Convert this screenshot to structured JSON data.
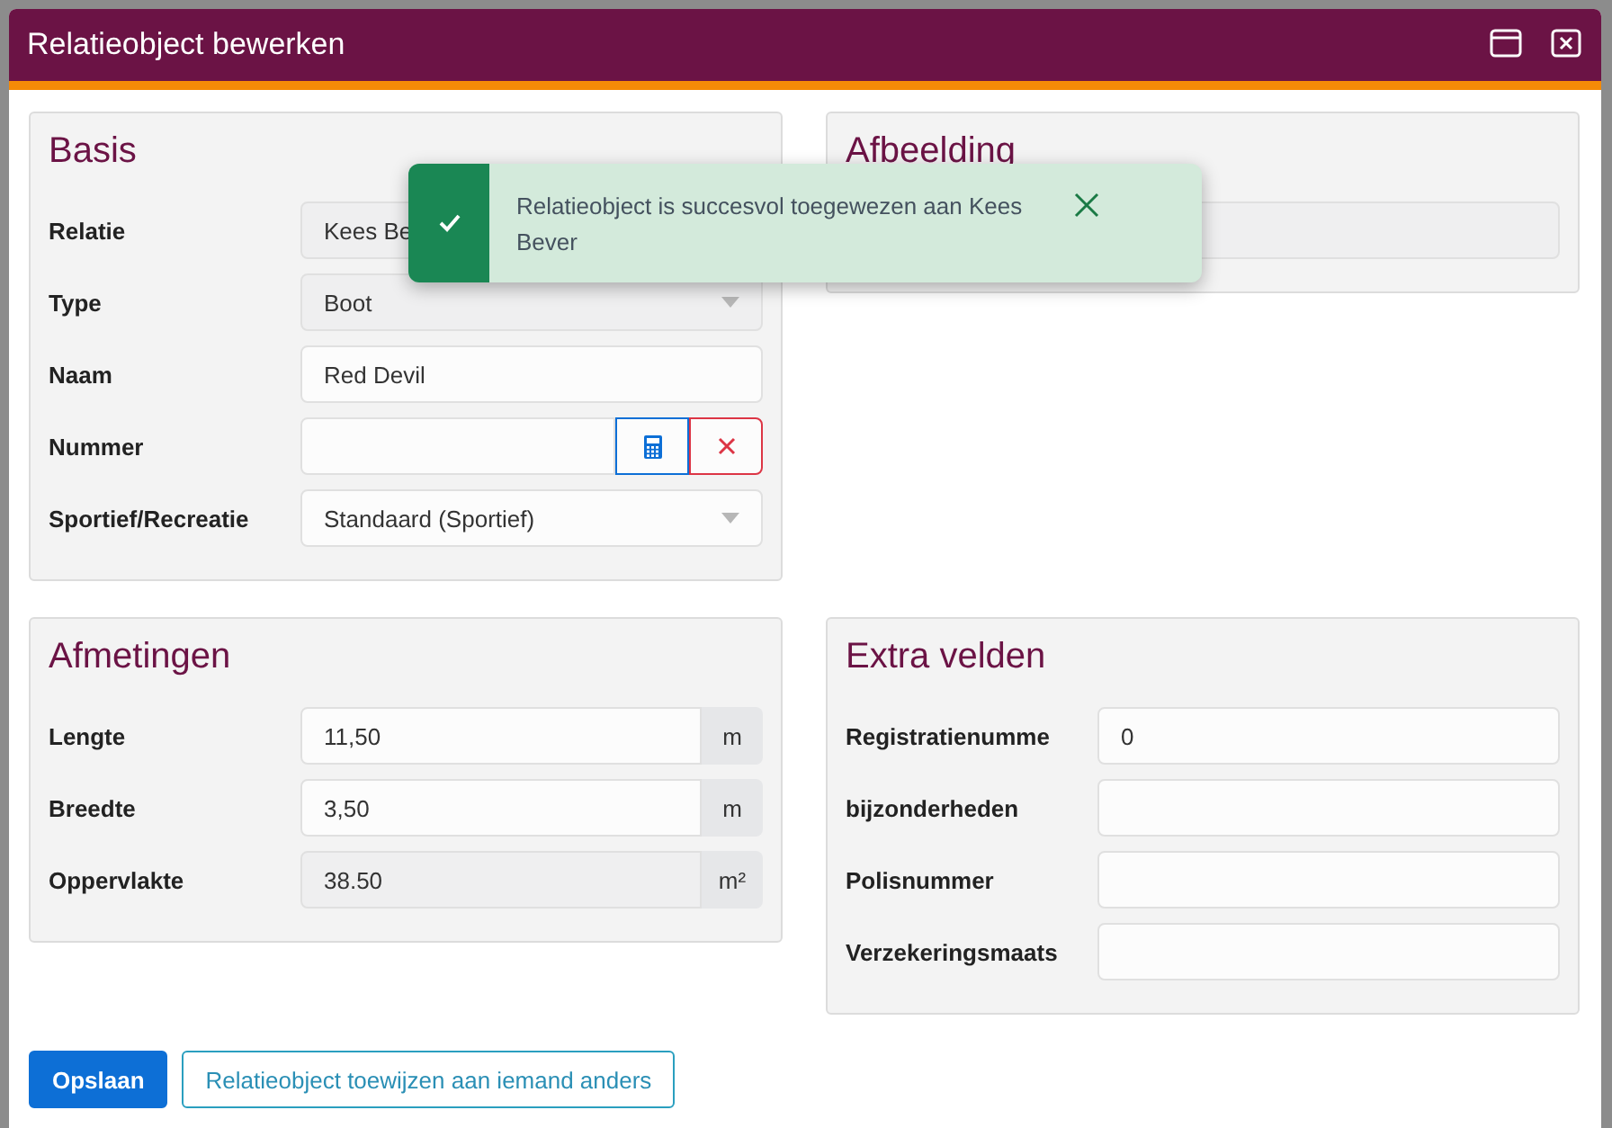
{
  "window": {
    "title": "Relatieobject bewerken"
  },
  "basis": {
    "title": "Basis",
    "rows": [
      {
        "label": "Relatie",
        "kind": "text",
        "value": "Kees Be",
        "disabled": true
      },
      {
        "label": "Type",
        "kind": "select",
        "value": "Boot",
        "disabled": true
      },
      {
        "label": "Naam",
        "kind": "text",
        "value": "Red Devil",
        "disabled": false
      },
      {
        "label": "Nummer",
        "kind": "generator",
        "value": "",
        "disabled": false
      },
      {
        "label": "Sportief/Recreatie",
        "kind": "select",
        "value": "Standaard (Sportief)",
        "disabled": false
      }
    ]
  },
  "afbeelding": {
    "title": "Afbeelding",
    "disabled": true
  },
  "afmetingen": {
    "title": "Afmetingen",
    "rows": [
      {
        "label": "Lengte",
        "value": "11,50",
        "unit": "m",
        "disabled": false
      },
      {
        "label": "Breedte",
        "value": "3,50",
        "unit": "m",
        "disabled": false
      },
      {
        "label": "Oppervlakte",
        "value": "38.50",
        "unit": "m²",
        "disabled": true
      }
    ]
  },
  "extra_velden": {
    "title": "Extra velden",
    "rows": [
      {
        "label": "Registratienumme",
        "value": "0"
      },
      {
        "label": "bijzonderheden",
        "value": ""
      },
      {
        "label": "Polisnummer",
        "value": ""
      },
      {
        "label": "Verzekeringsmaats",
        "value": ""
      }
    ]
  },
  "buttons": [
    {
      "label": "Opslaan",
      "kind": "primary"
    },
    {
      "label": "Relatieobject toewijzen aan iemand anders",
      "kind": "outline"
    }
  ],
  "toast": {
    "message": "Relatieobject is succesvol toegewezen aan Kees Bever",
    "kind": "success"
  }
}
